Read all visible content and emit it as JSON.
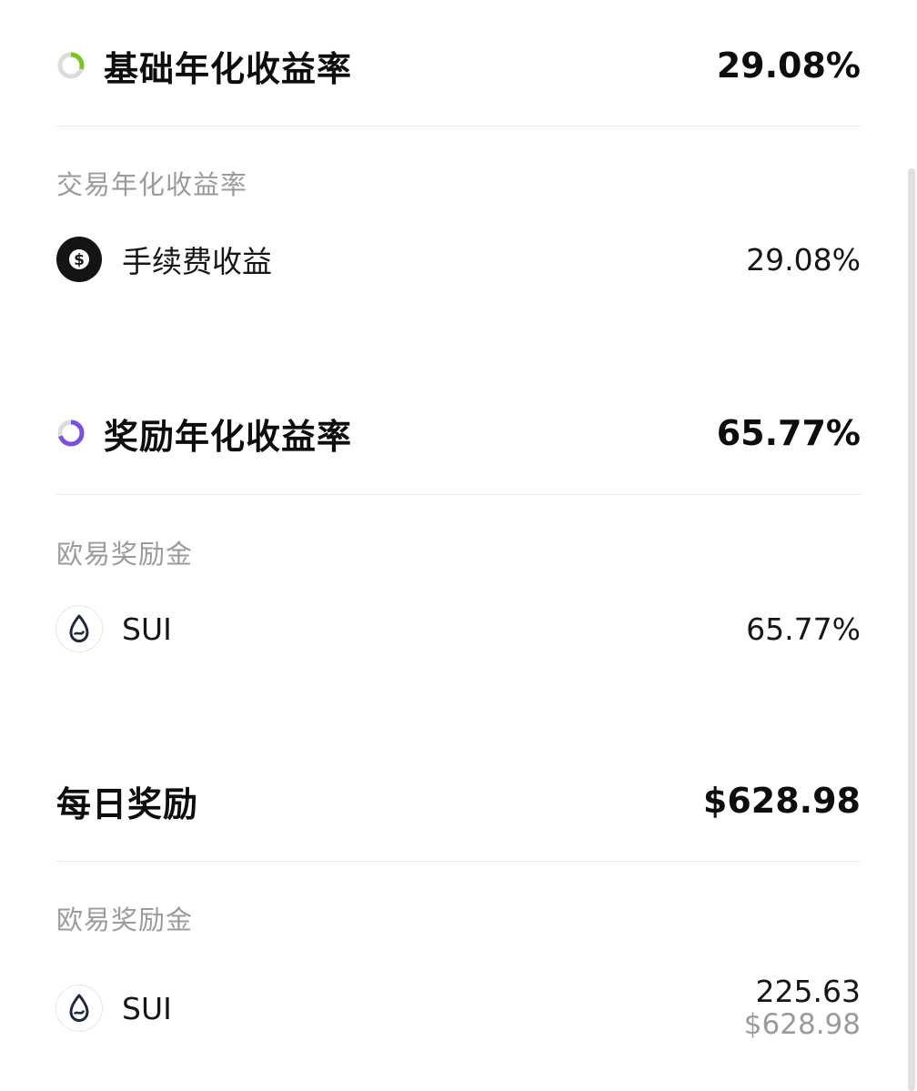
{
  "base_apr": {
    "title": "基础年化收益率",
    "value": "29.08%",
    "ring_color": "#7cc41e",
    "ring_fraction": 0.3,
    "sub_label": "交易年化收益率",
    "item": {
      "icon": "dollar-icon",
      "label": "手续费收益",
      "value": "29.08%"
    }
  },
  "reward_apr": {
    "title": "奖励年化收益率",
    "value": "65.77%",
    "ring_color": "#7b4fe0",
    "ring_fraction": 0.7,
    "sub_label": "欧易奖励金",
    "item": {
      "icon": "sui-drop-icon",
      "label": "SUI",
      "value": "65.77%"
    }
  },
  "daily_reward": {
    "title": "每日奖励",
    "value": "$628.98",
    "sub_label": "欧易奖励金",
    "item": {
      "icon": "sui-drop-icon",
      "label": "SUI",
      "amount": "225.63",
      "usd_value": "$628.98"
    }
  },
  "colors": {
    "text_primary": "#0d0d0d",
    "text_secondary": "#9b9b9b",
    "divider": "#ececec",
    "sui_icon": "#1e2a3a"
  }
}
